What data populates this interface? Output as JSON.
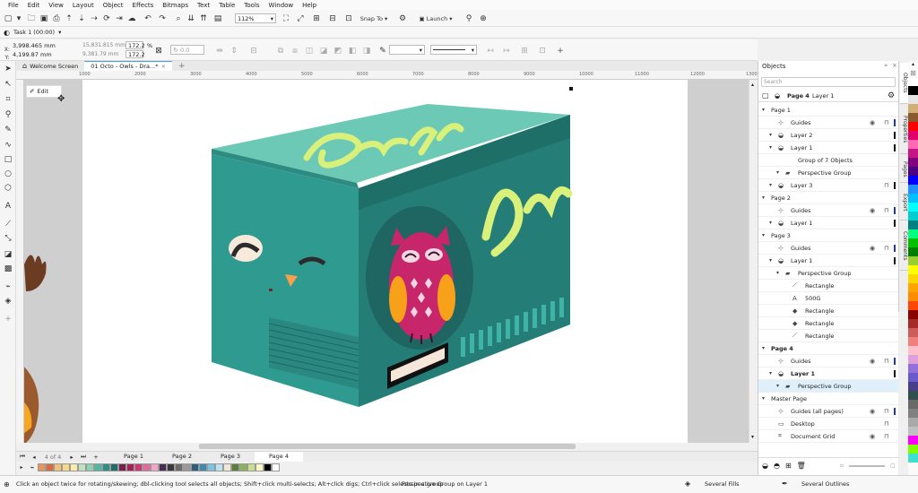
{
  "menu": [
    "File",
    "Edit",
    "View",
    "Layout",
    "Object",
    "Effects",
    "Bitmaps",
    "Text",
    "Table",
    "Tools",
    "Window",
    "Help"
  ],
  "toolbar": {
    "zoom": "112%",
    "snap_label": "Snap To",
    "launch_label": "Launch"
  },
  "task": "Task 1 (00:00)",
  "props": {
    "x": "3,998.465 mm",
    "y": "4,199.87 mm",
    "w": "15,831.815 mm",
    "h": "9,381.79 mm",
    "sx": "172.2",
    "sy": "172.2",
    "pct": "%",
    "angle": "0.0"
  },
  "doc_tabs": {
    "welcome": "Welcome Screen",
    "document": "01 Octo - Owls - Dra...*"
  },
  "ruler_labels": [
    "1000",
    "2000",
    "3000",
    "4000",
    "5000",
    "6000",
    "7000",
    "8000",
    "9000",
    "10000",
    "11000",
    "12000",
    "13000"
  ],
  "edit_tooltip": "Edit",
  "page_nav": {
    "current": "4",
    "of": "of",
    "total": "4"
  },
  "page_tabs": [
    "Page 1",
    "Page 2",
    "Page 3",
    "Page 4"
  ],
  "status": {
    "hint": "Click an object twice for rotating/skewing; dbl-clicking tool selects all objects; Shift+click multi-selects; Alt+click digs; Ctrl+click selects in a group",
    "selection": "Perspective Group on Layer 1",
    "fill": "Several Fills",
    "outline": "Several Outlines"
  },
  "objects_panel": {
    "title": "Objects",
    "search_placeholder": "Search",
    "header_page": "Page 4",
    "header_layer": "Layer 1",
    "rows": [
      {
        "label": "Page 1",
        "level": 0,
        "bold": false,
        "icon": "page"
      },
      {
        "label": "Guides",
        "level": 1,
        "icon": "guides",
        "eye": true,
        "lock": true,
        "color": "#1a3aa6"
      },
      {
        "label": "Layer 2",
        "level": 1,
        "icon": "layer",
        "color": "#111"
      },
      {
        "label": "Layer 1",
        "level": 1,
        "icon": "layer",
        "color": "#111"
      },
      {
        "label": "Group of 7 Objects",
        "level": 2,
        "icon": "none"
      },
      {
        "label": "Perspective Group",
        "level": 2,
        "icon": "group"
      },
      {
        "label": "Layer 3",
        "level": 1,
        "icon": "layer",
        "lock": true,
        "color": "#111"
      },
      {
        "label": "Page 2",
        "level": 0,
        "icon": "page"
      },
      {
        "label": "Guides",
        "level": 1,
        "icon": "guides",
        "eye": true,
        "lock": true,
        "color": "#1a3aa6"
      },
      {
        "label": "Layer 1",
        "level": 1,
        "icon": "layer",
        "color": "#111"
      },
      {
        "label": "Page 3",
        "level": 0,
        "icon": "page"
      },
      {
        "label": "Guides",
        "level": 1,
        "icon": "guides",
        "eye": true,
        "lock": true,
        "color": "#1a3aa6"
      },
      {
        "label": "Layer 1",
        "level": 1,
        "icon": "layer",
        "color": "#111"
      },
      {
        "label": "Perspective Group",
        "level": 2,
        "icon": "group"
      },
      {
        "label": "Rectangle",
        "level": 3,
        "icon": "line"
      },
      {
        "label": "500G",
        "level": 3,
        "icon": "text"
      },
      {
        "label": "Rectangle",
        "level": 3,
        "icon": "shape"
      },
      {
        "label": "Rectangle",
        "level": 3,
        "icon": "shape"
      },
      {
        "label": "Rectangle",
        "level": 3,
        "icon": "line"
      },
      {
        "label": "Page 4",
        "level": 0,
        "bold": true,
        "icon": "page"
      },
      {
        "label": "Guides",
        "level": 1,
        "icon": "guides",
        "eye": true,
        "lock": true,
        "color": "#1a3aa6"
      },
      {
        "label": "Layer 1",
        "level": 1,
        "bold": true,
        "icon": "layer",
        "color": "#111"
      },
      {
        "label": "Perspective Group",
        "level": 2,
        "icon": "group",
        "selected": true
      },
      {
        "label": "Master Page",
        "level": 0,
        "icon": "page"
      },
      {
        "label": "Guides (all pages)",
        "level": 1,
        "icon": "guides",
        "eye": true,
        "lock": true,
        "color": "#1a3aa6"
      },
      {
        "label": "Desktop",
        "level": 1,
        "icon": "desktop",
        "lock": true
      },
      {
        "label": "Document Grid",
        "level": 1,
        "icon": "grid",
        "eye": true,
        "lock": true
      }
    ]
  },
  "docker_tabs": [
    "Objects",
    "Properties",
    "Pages",
    "Export",
    "Comments"
  ],
  "palette_colors": [
    "#ffffff",
    "#000000",
    "#e6e6e6",
    "#d2ae79",
    "#8b5a2b",
    "#ff0000",
    "#e3006d",
    "#ff69b4",
    "#c71585",
    "#800080",
    "#4b0082",
    "#0000ff",
    "#1e90ff",
    "#00bfff",
    "#00ffff",
    "#00ced1",
    "#008080",
    "#00ff7f",
    "#00c000",
    "#008000",
    "#9acd32",
    "#ffff00",
    "#ffd700",
    "#ffa500",
    "#ff8c00",
    "#ff4500",
    "#8b0000",
    "#a52a2a",
    "#cd5c5c",
    "#f08080",
    "#ffc0cb",
    "#dda0dd",
    "#9370db",
    "#6a5acd",
    "#483d8b",
    "#2f4f4f",
    "#696969",
    "#808080",
    "#a9a9a9",
    "#c0c0c0",
    "#ff00ff",
    "#7fff00",
    "#40e0d0"
  ],
  "doc_palette": [
    "#e8955a",
    "#d86b3d",
    "#f2c27b",
    "#f6d98a",
    "#f9eab0",
    "#bfe3c0",
    "#8fd0b5",
    "#56b6a3",
    "#2f8f86",
    "#1f6d6a",
    "#7a1f49",
    "#a12359",
    "#c83a72",
    "#e06a9a",
    "#f2a6c3",
    "#4a2b52",
    "#3a3a3a",
    "#6b6b6b",
    "#9a9a9a",
    "#2e5f7a",
    "#3f88b0",
    "#7cc3e0",
    "#b9e3f2",
    "#f3e6d2",
    "#5b7f3a",
    "#8db35a",
    "#c7df8e",
    "#fbf4c3",
    "#000000",
    "#ffffff"
  ]
}
